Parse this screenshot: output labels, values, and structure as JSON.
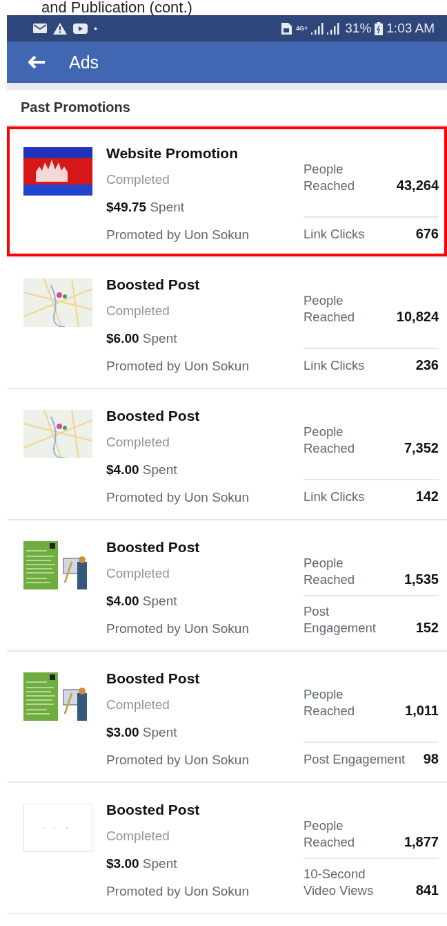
{
  "page_heading": "and Publication (cont.)",
  "status_bar": {
    "network": "4G+",
    "battery": "31%",
    "time": "1:03 AM"
  },
  "app_bar": {
    "title": "Ads"
  },
  "section": {
    "title": "Past Promotions"
  },
  "promotions": [
    {
      "title": "Website Promotion",
      "status": "Completed",
      "amount": "$49.75",
      "spent_label": "Spent",
      "promoter": "Promoted by Uon Sokun",
      "thumbnail": {
        "kind": "flag"
      },
      "highlighted": true,
      "metrics": [
        {
          "label": "People\nReached",
          "value": "43,264"
        },
        {
          "label": "Link Clicks",
          "value": "676"
        }
      ]
    },
    {
      "title": "Boosted Post",
      "status": "Completed",
      "amount": "$6.00",
      "spent_label": "Spent",
      "promoter": "Promoted by Uon Sokun",
      "thumbnail": {
        "kind": "map"
      },
      "highlighted": false,
      "metrics": [
        {
          "label": "People\nReached",
          "value": "10,824"
        },
        {
          "label": "Link Clicks",
          "value": "236"
        }
      ]
    },
    {
      "title": "Boosted Post",
      "status": "Completed",
      "amount": "$4.00",
      "spent_label": "Spent",
      "promoter": "Promoted by Uon Sokun",
      "thumbnail": {
        "kind": "map"
      },
      "highlighted": false,
      "metrics": [
        {
          "label": "People\nReached",
          "value": "7,352"
        },
        {
          "label": "Link Clicks",
          "value": "142"
        }
      ]
    },
    {
      "title": "Boosted Post",
      "status": "Completed",
      "amount": "$4.00",
      "spent_label": "Spent",
      "promoter": "Promoted by Uon Sokun",
      "thumbnail": {
        "kind": "infographic"
      },
      "highlighted": false,
      "metrics": [
        {
          "label": "People\nReached",
          "value": "1,535"
        },
        {
          "label": "Post\nEngagement",
          "value": "152"
        }
      ]
    },
    {
      "title": "Boosted Post",
      "status": "Completed",
      "amount": "$3.00",
      "spent_label": "Spent",
      "promoter": "Promoted by Uon Sokun",
      "thumbnail": {
        "kind": "infographic"
      },
      "highlighted": false,
      "metrics": [
        {
          "label": "People\nReached",
          "value": "1,011"
        },
        {
          "label": "Post Engagement",
          "value": "98"
        }
      ]
    },
    {
      "title": "Boosted Post",
      "status": "Completed",
      "amount": "$3.00",
      "spent_label": "Spent",
      "promoter": "Promoted by Uon Sokun",
      "thumbnail": {
        "kind": "blank"
      },
      "highlighted": false,
      "metrics": [
        {
          "label": "People\nReached",
          "value": "1,877"
        },
        {
          "label": "10-Second\nVideo Views",
          "value": "841"
        }
      ]
    }
  ]
}
